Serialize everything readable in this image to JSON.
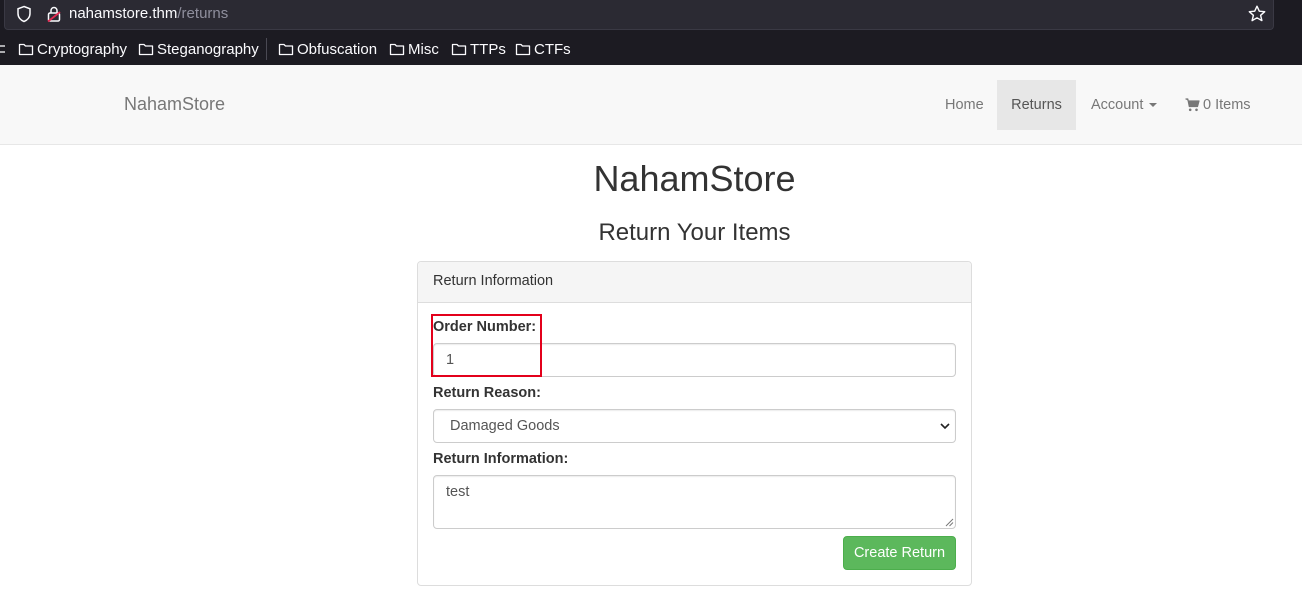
{
  "browser": {
    "url_host": "nahamstore.thm",
    "url_path": "/returns",
    "bookmarks": [
      {
        "label": "Cryptography"
      },
      {
        "label": "Steganography"
      },
      {
        "label": "Obfuscation"
      },
      {
        "label": "Misc"
      },
      {
        "label": "TTPs"
      },
      {
        "label": "CTFs"
      }
    ]
  },
  "navbar": {
    "brand": "NahamStore",
    "home": "Home",
    "returns": "Returns",
    "account": "Account",
    "cart": "0 Items"
  },
  "page": {
    "title": "NahamStore",
    "subtitle": "Return Your Items"
  },
  "panel": {
    "heading": "Return Information",
    "order_label": "Order Number:",
    "order_value": "1",
    "reason_label": "Return Reason:",
    "reason_selected": "Damaged Goods",
    "info_label": "Return Information:",
    "info_value": "test",
    "submit_label": "Create Return"
  },
  "colors": {
    "submit_bg": "#5cb85c",
    "highlight": "#e3001b",
    "active_nav_bg": "#e7e7e7"
  },
  "icons": {
    "url_shield": "shield-icon",
    "url_lock": "lock-icon",
    "url_star": "star-icon",
    "bookmark": "folder-icon",
    "cart": "cart-icon",
    "select": "chevron-down-icon"
  }
}
